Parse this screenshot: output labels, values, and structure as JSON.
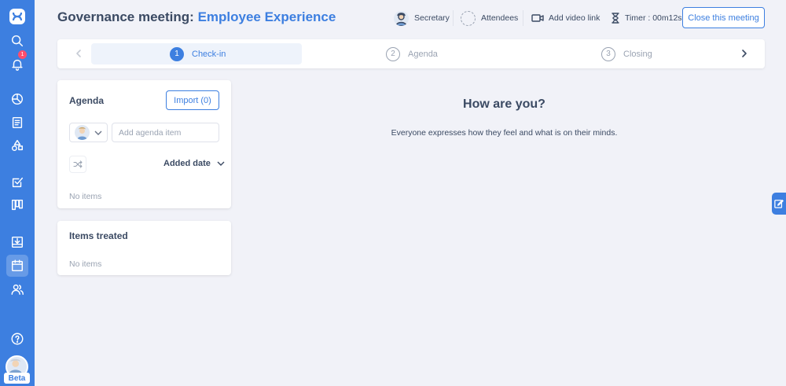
{
  "header": {
    "title_prefix": "Governance meeting:",
    "title_accent": "Employee Experience",
    "secretary_label": "Secretary",
    "attendees_label": "Attendees",
    "video_link_label": "Add video link",
    "timer_label": "Timer : 00m12s",
    "close_button": "Close this meeting"
  },
  "sidebar": {
    "notification_count": "1",
    "beta_label": "Beta",
    "icons": [
      "logo-icon",
      "search-icon",
      "bell-icon",
      "dashboard-icon",
      "document-icon",
      "shapes-icon",
      "checkbox-icon",
      "kanban-icon",
      "inbox-icon",
      "calendar-icon",
      "users-icon",
      "help-icon"
    ],
    "active_item": "calendar-icon"
  },
  "steps": {
    "items": [
      {
        "number": "1",
        "label": "Check-in",
        "active": true
      },
      {
        "number": "2",
        "label": "Agenda",
        "active": false
      },
      {
        "number": "3",
        "label": "Closing",
        "active": false
      }
    ]
  },
  "agenda_card": {
    "title": "Agenda",
    "import_button": "Import (0)",
    "input_placeholder": "Add agenda item",
    "sort_label": "Added date",
    "empty_text": "No items"
  },
  "treated_card": {
    "title": "Items treated",
    "empty_text": "No items"
  },
  "main": {
    "heading": "How are you?",
    "description": "Everyone expresses how they feel and what is on their minds."
  },
  "colors": {
    "accent": "#3d7fe0",
    "background": "#f1f2f8",
    "text": "#3b4a63",
    "muted": "#9aa3b2",
    "badge": "#ff4d6d"
  }
}
